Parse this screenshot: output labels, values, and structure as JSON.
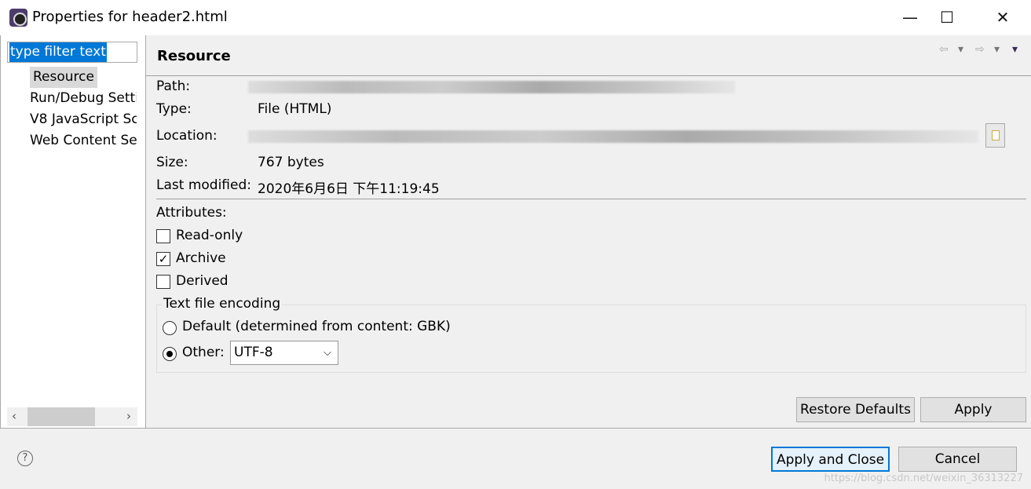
{
  "window": {
    "title": "Properties for header2.html",
    "minimize": "—",
    "maximize": "☐",
    "close": "✕"
  },
  "sidebar": {
    "filter_value": "type filter text",
    "items": [
      {
        "label": "Resource"
      },
      {
        "label": "Run/Debug Settings"
      },
      {
        "label": "V8 JavaScript Sc"
      },
      {
        "label": "Web Content Se"
      }
    ],
    "scroll_left": "‹",
    "scroll_right": "›"
  },
  "page": {
    "heading": "Resource",
    "nav_back": "⇦",
    "nav_fwd": "⇨",
    "dropdown": "▾",
    "path_label": "Path:",
    "type_label": "Type:",
    "type_value": "File  (HTML)",
    "location_label": "Location:",
    "size_label": "Size:",
    "size_value": "767  bytes",
    "modified_label": "Last modified:",
    "modified_value": "2020年6月6日 下午11:19:45",
    "attributes_label": "Attributes:",
    "attributes": [
      {
        "label": "Read-only",
        "checked": false
      },
      {
        "label": "Archive",
        "checked": true
      },
      {
        "label": "Derived",
        "checked": false
      }
    ],
    "encoding": {
      "label": "Text file encoding",
      "default_label": "Default (determined from content: GBK)",
      "other_label": "Other:",
      "selected": "other",
      "value": "UTF-8"
    },
    "restore_defaults": "Restore Defaults",
    "apply": "Apply"
  },
  "footer": {
    "help": "?",
    "apply_close": "Apply and Close",
    "cancel": "Cancel",
    "watermark": "https://blog.csdn.net/weixin_36313227"
  }
}
